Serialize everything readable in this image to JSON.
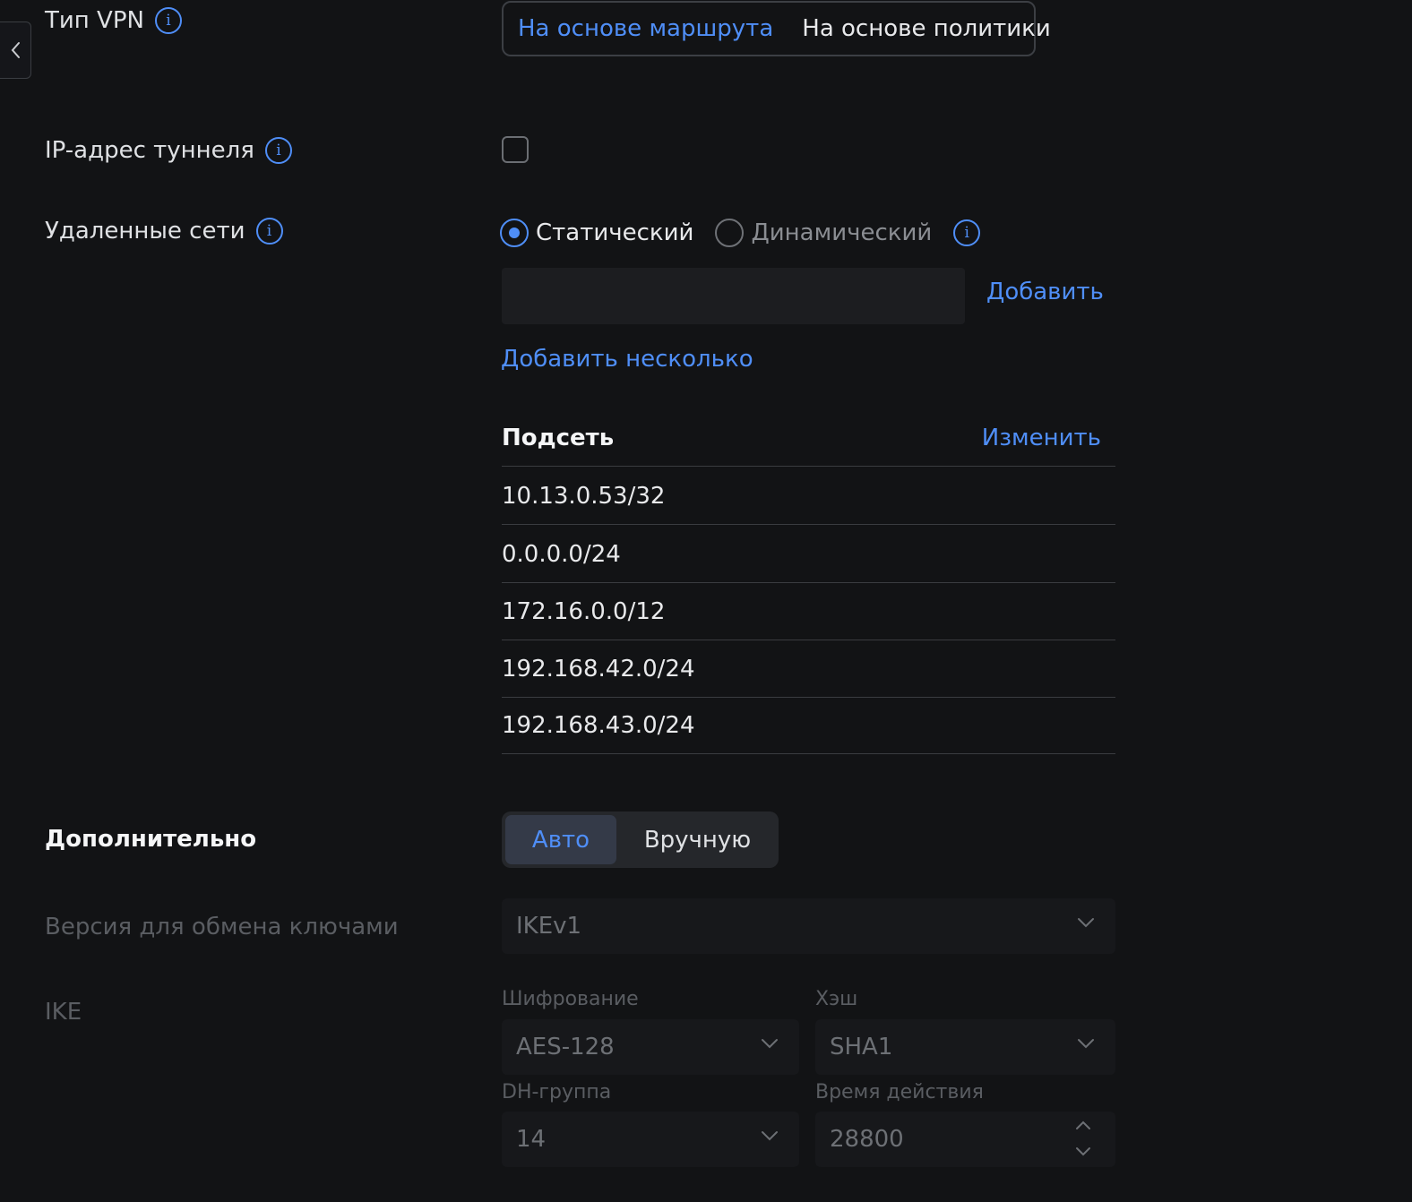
{
  "vpn_type": {
    "label": "Тип VPN",
    "options": [
      "На основе маршрута",
      "На основе политики"
    ],
    "selected_index": 0
  },
  "tunnel_ip": {
    "label": "IP-адрес туннеля",
    "checked": false
  },
  "remote_networks": {
    "label": "Удаленные сети",
    "radio_options": [
      "Статический",
      "Динамический"
    ],
    "selected_index": 0,
    "input_value": "",
    "add_label": "Добавить",
    "add_multiple_label": "Добавить несколько",
    "table": {
      "header": "Подсеть",
      "edit_label": "Изменить",
      "rows": [
        "10.13.0.53/32",
        "0.0.0.0/24",
        "172.16.0.0/12",
        "192.168.42.0/24",
        "192.168.43.0/24"
      ]
    }
  },
  "advanced": {
    "label": "Дополнительно",
    "options": [
      "Авто",
      "Вручную"
    ],
    "selected_index": 0
  },
  "key_exchange": {
    "label": "Версия для обмена ключами",
    "value": "IKEv1"
  },
  "ike": {
    "label": "IKE",
    "encryption_label": "Шифрование",
    "encryption_value": "AES-128",
    "hash_label": "Хэш",
    "hash_value": "SHA1",
    "dh_label": "DH-группа",
    "dh_value": "14",
    "lifetime_label": "Время действия",
    "lifetime_value": "28800"
  },
  "colors": {
    "accent": "#4f8ef7",
    "background": "#121315"
  }
}
